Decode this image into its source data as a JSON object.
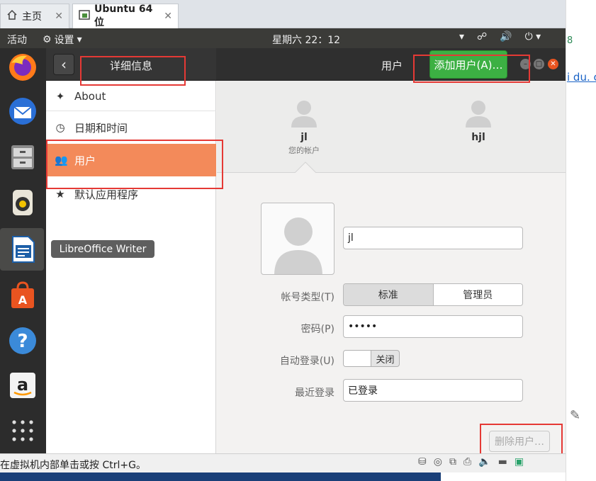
{
  "vmware": {
    "tabs": [
      {
        "label": "主页"
      },
      {
        "label": "Ubuntu 64 位"
      }
    ],
    "status_hint": "在虚拟机内部单击或按 Ctrl+G。"
  },
  "host": {
    "fragment_number": "8",
    "fragment_link": "i du. c"
  },
  "topbar": {
    "activities": "活动",
    "app_menu": "设置",
    "clock": "星期六 22：12"
  },
  "dock": {
    "items": [
      "firefox-icon",
      "thunderbird-icon",
      "files-icon",
      "rhythmbox-icon",
      "libreoffice-writer-icon",
      "software-center-icon",
      "help-icon",
      "amazon-icon",
      "app-grid-icon"
    ],
    "tooltip": "LibreOffice Writer"
  },
  "settings": {
    "sidebar_title": "详细信息",
    "panel_title": "用户",
    "add_user": "添加用户(A)…",
    "sidebar_items": [
      {
        "label": "About"
      },
      {
        "label": "日期和时间"
      },
      {
        "label": "用户"
      },
      {
        "label": "默认应用程序"
      }
    ]
  },
  "users": [
    {
      "name": "jl",
      "sub": "您的帐户"
    },
    {
      "name": "hjl",
      "sub": ""
    }
  ],
  "form": {
    "username": "jl",
    "account_type_label": "帐号类型(T)",
    "account_type_options": [
      "标准",
      "管理员"
    ],
    "password_label": "密码(P)",
    "password_value": "•••••",
    "autologin_label": "自动登录(U)",
    "autologin_state": "关闭",
    "last_login_label": "最近登录",
    "last_login_value": "已登录",
    "delete_user": "删除用户…"
  },
  "colors": {
    "accent_orange": "#f38a5a",
    "add_button_green": "#3cb043",
    "annotation_red": "#e53935"
  }
}
